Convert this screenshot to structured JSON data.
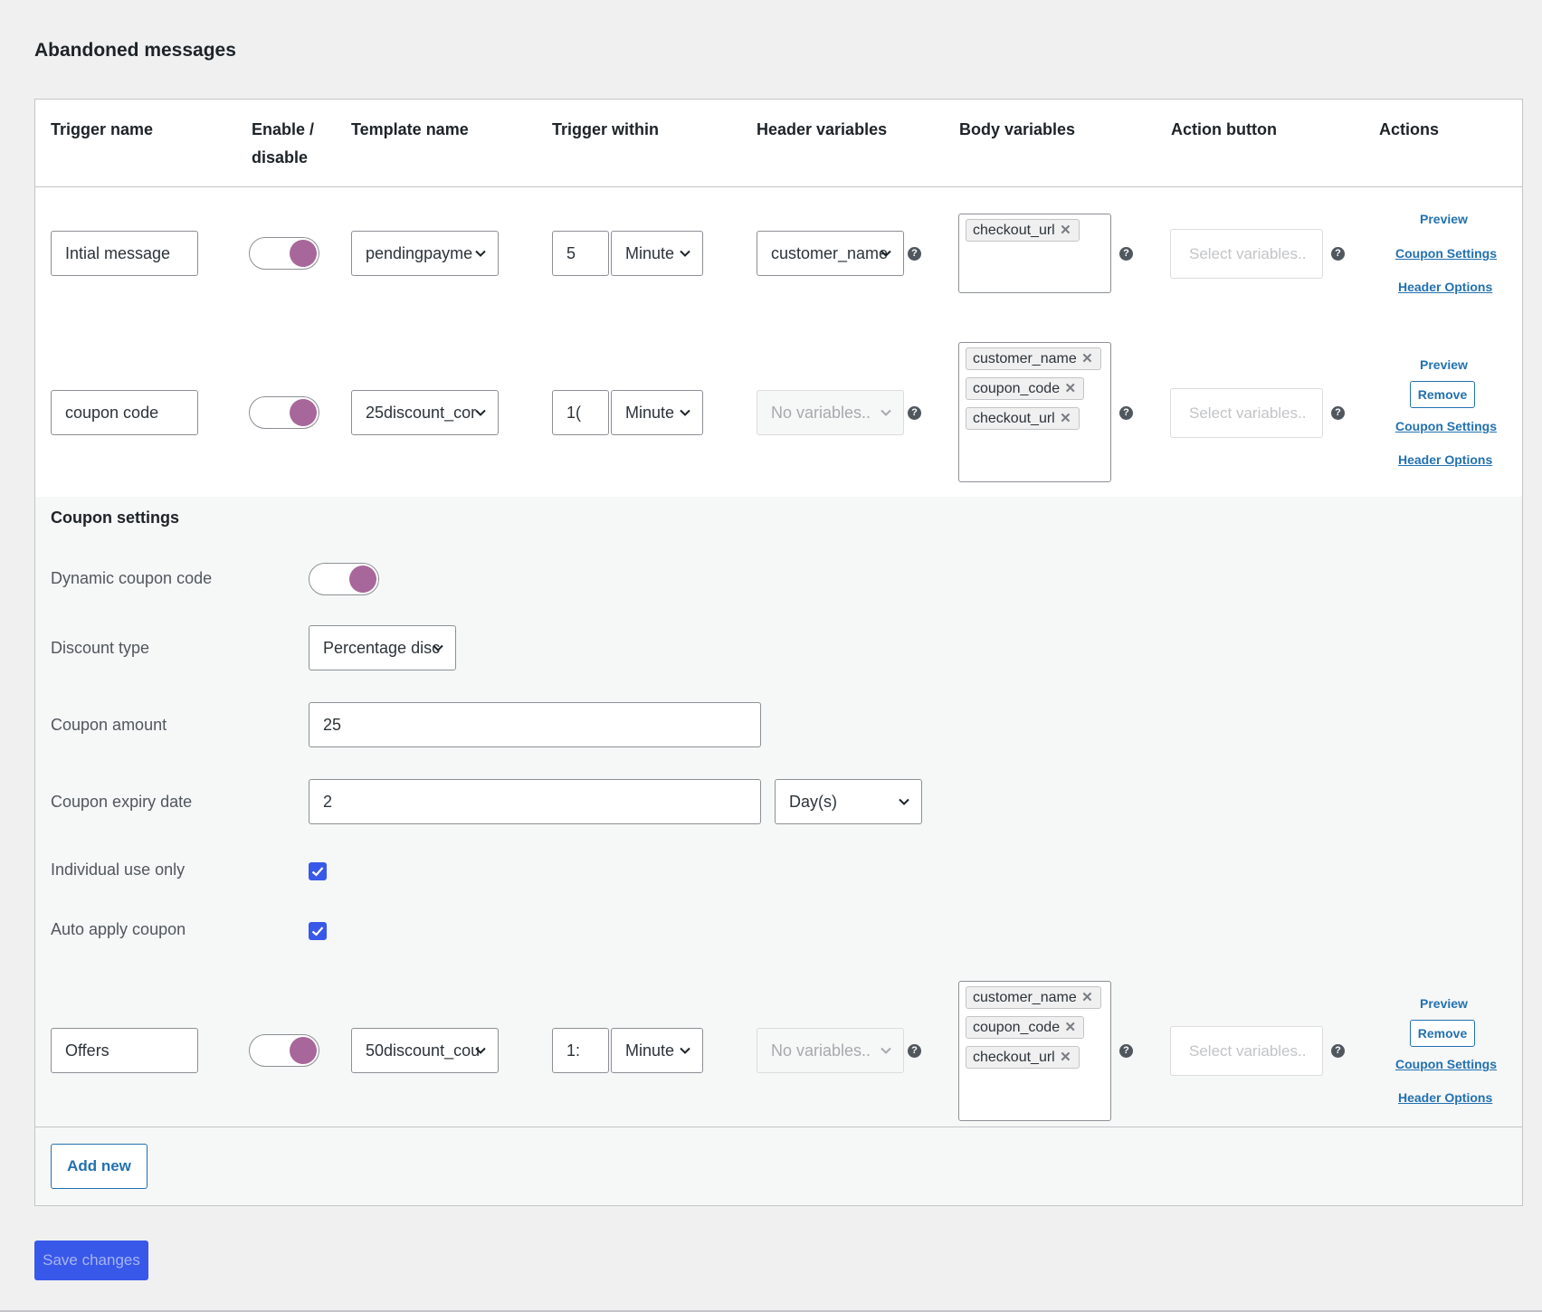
{
  "page": {
    "title": "Abandoned messages"
  },
  "columns": {
    "trigger_name": "Trigger name",
    "enable": "Enable /",
    "enable2": "disable",
    "template_name": "Template name",
    "trigger_within": "Trigger within",
    "header_variables": "Header variables",
    "body_variables": "Body variables",
    "action_button": "Action button",
    "actions": "Actions"
  },
  "rows": [
    {
      "trigger_name": "Intial message",
      "enabled": true,
      "template": "pendingpayme",
      "trigger_value": "5",
      "trigger_unit": "Minute",
      "header_variable": "customer_name",
      "header_disabled": false,
      "body_tags": [
        "checkout_url"
      ],
      "action_placeholder": "Select variables..",
      "preview": "Preview",
      "coupon_settings": "Coupon Settings",
      "header_options": "Header Options"
    },
    {
      "trigger_name": "coupon code",
      "enabled": true,
      "template": "25discount_cor",
      "trigger_value": "1(",
      "trigger_unit": "Minute",
      "header_variable": "No variables..",
      "header_disabled": true,
      "body_tags": [
        "customer_name",
        "coupon_code",
        "checkout_url"
      ],
      "action_placeholder": "Select variables..",
      "preview": "Preview",
      "remove": "Remove",
      "coupon_settings": "Coupon Settings",
      "header_options": "Header Options"
    },
    {
      "trigger_name": "Offers",
      "enabled": true,
      "template": "50discount_cou",
      "trigger_value": "1:",
      "trigger_unit": "Minute",
      "header_variable": "No variables..",
      "header_disabled": true,
      "body_tags": [
        "customer_name",
        "coupon_code",
        "checkout_url"
      ],
      "action_placeholder": "Select variables..",
      "preview": "Preview",
      "remove": "Remove",
      "coupon_settings": "Coupon Settings",
      "header_options": "Header Options"
    }
  ],
  "coupon": {
    "title": "Coupon settings",
    "dynamic_label": "Dynamic coupon code",
    "dynamic_enabled": true,
    "discount_type_label": "Discount type",
    "discount_type": "Percentage disc",
    "amount_label": "Coupon amount",
    "amount": "25",
    "expiry_label": "Coupon expiry date",
    "expiry_value": "2",
    "expiry_unit": "Day(s)",
    "individual_label": "Individual use only",
    "individual_checked": true,
    "auto_apply_label": "Auto apply coupon",
    "auto_apply_checked": true
  },
  "buttons": {
    "add_new": "Add new",
    "save": "Save changes"
  },
  "help_glyph": "?",
  "remove_glyph": "✕",
  "colors": {
    "accent": "#2271b1",
    "toggle_knob": "#a7679a",
    "checkbox": "#3858e9",
    "save_button": "#3858e9"
  }
}
